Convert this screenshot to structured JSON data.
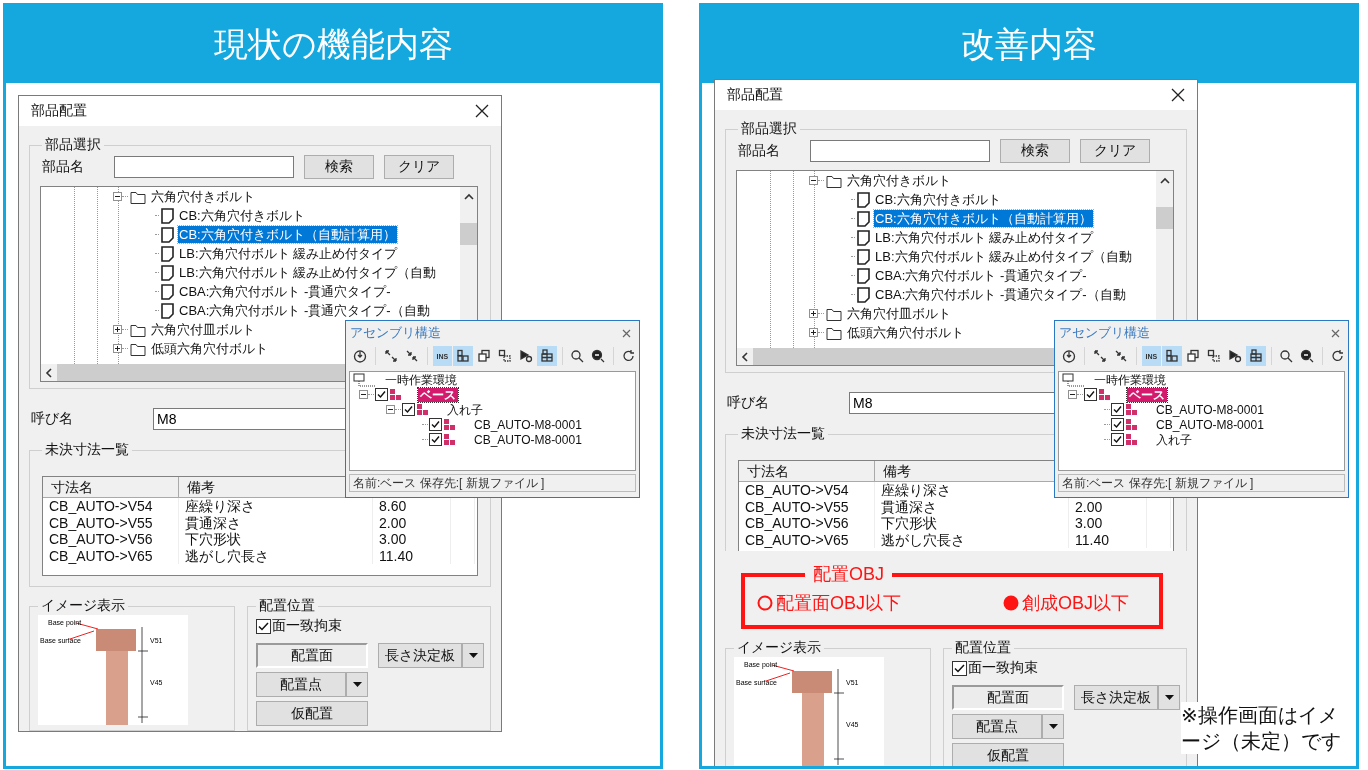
{
  "panels": [
    {
      "title": "現状の機能内容",
      "dialog": {
        "title": "部品配置",
        "selection": {
          "legend": "部品選択",
          "name_label": "部品名",
          "search_button": "検索",
          "clear_button": "クリア",
          "tree": [
            {
              "label": "六角穴付きボルト",
              "expanded": true,
              "children": [
                {
                  "label": "CB:六角穴付きボルト",
                  "selected": false
                },
                {
                  "label": "CB:六角穴付きボルト（自動計算用）",
                  "selected": true
                },
                {
                  "label": "LB:六角穴付ボルト 緩み止め付タイプ",
                  "selected": false
                },
                {
                  "label": "LB:六角穴付ボルト 緩み止め付タイプ（自動",
                  "selected": false
                },
                {
                  "label": "CBA:六角穴付ボルト -貫通穴タイプ-",
                  "selected": false
                },
                {
                  "label": "CBA:六角穴付ボルト -貫通穴タイプ-（自動",
                  "selected": false
                }
              ]
            },
            {
              "label": "六角穴付皿ボルト",
              "expanded": false
            },
            {
              "label": "低頭六角穴付ボルト",
              "expanded": false
            }
          ]
        },
        "call_name": {
          "label": "呼び名",
          "value": "M8"
        },
        "dimensions": {
          "legend": "未決寸法一覧",
          "columns": [
            "寸法名",
            "備考"
          ],
          "rows": [
            {
              "name": "CB_AUTO->V54",
              "note": "座繰り深さ",
              "value": "8.60"
            },
            {
              "name": "CB_AUTO->V55",
              "note": "貫通深さ",
              "value": "2.00"
            },
            {
              "name": "CB_AUTO->V56",
              "note": "下穴形状",
              "value": "3.00"
            },
            {
              "name": "CB_AUTO->V65",
              "note": "逃がし穴長さ",
              "value": "11.40"
            }
          ]
        },
        "image": {
          "legend": "イメージ表示",
          "labels": [
            "Base point",
            "Base surface",
            "V51",
            "V45"
          ]
        },
        "placement": {
          "legend": "配置位置",
          "checkbox": {
            "label": "面一致拘束",
            "checked": true
          },
          "buttons": [
            {
              "label": "配置面",
              "selected": true,
              "dropdown": false
            },
            {
              "label": "長さ決定板",
              "selected": false,
              "dropdown": true
            },
            {
              "label": "配置点",
              "selected": false,
              "dropdown": true
            },
            {
              "label": "仮配置",
              "selected": false,
              "dropdown": false
            }
          ]
        }
      },
      "assembly": {
        "title": "アセンブリ構造",
        "toolbar": [
          {
            "on": false
          },
          {
            "on": false
          },
          {
            "on": false
          },
          {
            "label": "INS",
            "on": true
          },
          {
            "on": true
          },
          {
            "on": false
          },
          {
            "on": false
          },
          {
            "on": false
          },
          {
            "on": true
          },
          {
            "on": false
          },
          {
            "on": false
          },
          {
            "on": false
          }
        ],
        "tree": [
          {
            "label": "一時作業環境",
            "kind": "workspace",
            "children": [
              {
                "label": "ベース",
                "kind": "part",
                "checked": true,
                "selected": true,
                "expanded": true,
                "children": [
                  {
                    "label": "入れ子",
                    "kind": "part",
                    "checked": true,
                    "selected": false,
                    "expanded": true,
                    "children": [
                      {
                        "label": "CB_AUTO-M8-0001",
                        "kind": "part",
                        "checked": true,
                        "selected": false
                      },
                      {
                        "label": "CB_AUTO-M8-0001",
                        "kind": "part",
                        "checked": true,
                        "selected": false
                      }
                    ]
                  }
                ]
              }
            ]
          }
        ],
        "status": "名前:ベース 保存先:[ 新規ファイル ]"
      }
    },
    {
      "title": "改善内容",
      "dialog": {
        "title": "部品配置",
        "selection": {
          "legend": "部品選択",
          "name_label": "部品名",
          "search_button": "検索",
          "clear_button": "クリア",
          "tree": [
            {
              "label": "六角穴付きボルト",
              "expanded": true,
              "children": [
                {
                  "label": "CB:六角穴付きボルト",
                  "selected": false
                },
                {
                  "label": "CB:六角穴付きボルト（自動計算用）",
                  "selected": true
                },
                {
                  "label": "LB:六角穴付ボルト 緩み止め付タイプ",
                  "selected": false
                },
                {
                  "label": "LB:六角穴付ボルト 緩み止め付タイプ（自動",
                  "selected": false
                },
                {
                  "label": "CBA:六角穴付ボルト -貫通穴タイプ-",
                  "selected": false
                },
                {
                  "label": "CBA:六角穴付ボルト -貫通穴タイプ-（自動",
                  "selected": false
                }
              ]
            },
            {
              "label": "六角穴付皿ボルト",
              "expanded": false
            },
            {
              "label": "低頭六角穴付ボルト",
              "expanded": false
            }
          ]
        },
        "call_name": {
          "label": "呼び名",
          "value": "M8"
        },
        "dimensions": {
          "legend": "未決寸法一覧",
          "columns": [
            "寸法名",
            "備考"
          ],
          "rows": [
            {
              "name": "CB_AUTO->V54",
              "note": "座繰り深さ"
            },
            {
              "name": "CB_AUTO->V55",
              "note": "貫通深さ",
              "value": "2.00"
            },
            {
              "name": "CB_AUTO->V56",
              "note": "下穴形状",
              "value": "3.00"
            },
            {
              "name": "CB_AUTO->V65",
              "note": "逃がし穴長さ",
              "value": "11.40"
            }
          ]
        },
        "placement_obj": {
          "title": "配置OBJ",
          "options": [
            {
              "label": "配置面OBJ以下",
              "selected": false
            },
            {
              "label": "創成OBJ以下",
              "selected": true
            }
          ]
        },
        "image": {
          "legend": "イメージ表示",
          "labels": [
            "Base point",
            "Base surface",
            "V51",
            "V45"
          ]
        },
        "placement": {
          "legend": "配置位置",
          "checkbox": {
            "label": "面一致拘束",
            "checked": true
          },
          "buttons": [
            {
              "label": "配置面",
              "selected": true,
              "dropdown": false
            },
            {
              "label": "長さ決定板",
              "selected": false,
              "dropdown": true
            },
            {
              "label": "配置点",
              "selected": false,
              "dropdown": true
            },
            {
              "label": "仮配置",
              "selected": false,
              "dropdown": false
            }
          ]
        }
      },
      "assembly": {
        "title": "アセンブリ構造",
        "toolbar": [
          {
            "on": false
          },
          {
            "on": false
          },
          {
            "on": false
          },
          {
            "label": "INS",
            "on": true
          },
          {
            "on": true
          },
          {
            "on": false
          },
          {
            "on": false
          },
          {
            "on": false
          },
          {
            "on": true
          },
          {
            "on": false
          },
          {
            "on": false
          },
          {
            "on": false
          }
        ],
        "tree": [
          {
            "label": "一時作業環境",
            "kind": "workspace",
            "children": [
              {
                "label": "ベース",
                "kind": "part",
                "checked": true,
                "selected": true,
                "expanded": true,
                "children": [
                  {
                    "label": "CB_AUTO-M8-0001",
                    "kind": "part",
                    "checked": true,
                    "selected": false
                  },
                  {
                    "label": "CB_AUTO-M8-0001",
                    "kind": "part",
                    "checked": true,
                    "selected": false
                  },
                  {
                    "label": "入れ子",
                    "kind": "part",
                    "checked": true,
                    "selected": false
                  }
                ]
              }
            ]
          }
        ],
        "status": "名前:ベース 保存先:[ 新規ファイル ]"
      }
    }
  ],
  "note": "※操作画面はイメージ（未定）です"
}
